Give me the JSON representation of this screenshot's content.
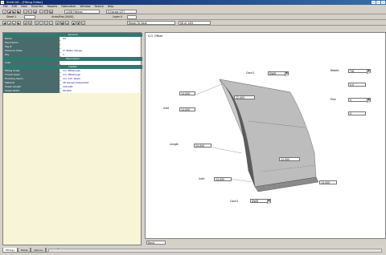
{
  "title_bar": {
    "title": "ShiftCAD - [Fitting Editor]"
  },
  "menu": [
    "File",
    "Edit",
    "View",
    "Favorites",
    "Reports",
    "Fabrication",
    "Window",
    "Search",
    "Help"
  ],
  "toolbar1": {
    "fitting_field": "1208 Fittings",
    "change_field": "[Change 0/7]"
  },
  "toolbar2": {
    "item_label": "Sheet 1",
    "item_field": "",
    "unit_label": "Undo/Rdo [0/0/0]",
    "layer_label": "Layer 0",
    "layer_field": ""
  },
  "toolbar3": {
    "command_field": "Ready To Next",
    "position_field": "08 of 1/05"
  },
  "properties": {
    "rows_top": [
      {
        "key": "Name",
        "value": "04"
      },
      {
        "key": "Description",
        "value": ""
      },
      {
        "key": "Tag #",
        "value": ""
      },
      {
        "key": "Pressure Class",
        "value": "2\" Water Gauge"
      },
      {
        "key": "Qty",
        "value": "1"
      }
    ],
    "section_description": "Description",
    "rows_mid": [
      {
        "key": "Load",
        "value": ""
      }
    ],
    "section_details": "Details",
    "rows_bottom": [
      {
        "key": "Fitting Scale",
        "value": "1in: Pittsburgh"
      },
      {
        "key": "Throat Seam",
        "value": "1in: Pittsburgh"
      },
      {
        "key": "Finishing Seam",
        "value": "1in: 1/2\" Seam"
      },
      {
        "key": "Material",
        "value": "26 Gauge Galvanized"
      },
      {
        "key": "Sheet Length",
        "value": "120.000"
      },
      {
        "key": "Sheet Width",
        "value": "60.000"
      }
    ]
  },
  "drawing": {
    "title": "S.O. Offset",
    "labels": {
      "conn1": "Conn1",
      "conn2": "Conn2",
      "rotate": "Rotate",
      "plan": "Plan",
      "inlet": "Inlet",
      "length": "Length",
      "inlet_lower": "Inlet"
    },
    "values": {
      "conn1_sel": "DWD",
      "conn2_sel": "DWD",
      "rotate_sel": "TW",
      "plan_sel": "S",
      "top_width": "14.000",
      "top_depth": "12.000",
      "left_width": "14.000",
      "left_height": "14.000",
      "length": "24.000",
      "offset": "12.000",
      "bottom_width": "14.000",
      "bottom_height": "14.000",
      "rotate_value": "0.0",
      "plan_value": "0"
    }
  },
  "status": {
    "field": "Basic"
  },
  "tabs": [
    "Fittings",
    "Fields",
    "Macros",
    "Stack"
  ],
  "colors": {
    "header_teal": "#4a6b6b",
    "section_green": "#2f7a70",
    "panel_bg": "#f7f4d8",
    "value_text": "#00008b"
  }
}
